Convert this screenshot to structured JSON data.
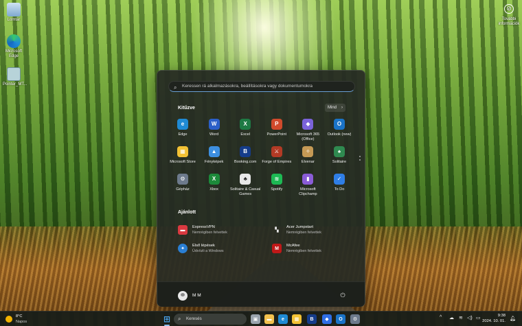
{
  "desktop": {
    "icons": [
      {
        "label": "Lomtár",
        "icon": "recycle-bin-icon",
        "color": "#9ec6e8"
      },
      {
        "label": "Microsoft Edge",
        "icon": "edge-icon",
        "color": "#1e8bd6"
      },
      {
        "label": "Pointer_MT...",
        "icon": "pointer-app-icon",
        "color": "#b7d3d9"
      }
    ],
    "widget_top_right": {
      "label": "További információk",
      "icon": "info-circle-icon"
    }
  },
  "start_menu": {
    "search_placeholder": "Keressen rá alkalmazásokra, beállításokra vagy dokumentumokra",
    "pinned_title": "Kitűzve",
    "all_button": "Mind",
    "pinned": [
      {
        "label": "Edge",
        "icon": "edge-icon",
        "color": "#1f8ad4"
      },
      {
        "label": "Word",
        "icon": "word-icon",
        "color": "#2b5fc8"
      },
      {
        "label": "Excel",
        "icon": "excel-icon",
        "color": "#1e7a44"
      },
      {
        "label": "PowerPoint",
        "icon": "powerpoint-icon",
        "color": "#d04a2c"
      },
      {
        "label": "Microsoft 365 (Office)",
        "icon": "microsoft-365-icon",
        "color": "#7b63d9"
      },
      {
        "label": "Outlook (new)",
        "icon": "outlook-icon",
        "color": "#1a73c7"
      },
      {
        "label": "Microsoft Store",
        "icon": "store-icon",
        "color": "#f3c235"
      },
      {
        "label": "Fényképek",
        "icon": "photos-icon",
        "color": "#3d8fe0"
      },
      {
        "label": "Booking.com",
        "icon": "booking-icon",
        "color": "#153c8a"
      },
      {
        "label": "Forge of Empires",
        "icon": "forge-of-empires-icon",
        "color": "#b23a25"
      },
      {
        "label": "Elvenar",
        "icon": "elvenar-icon",
        "color": "#c59a55"
      },
      {
        "label": "Solitaire",
        "icon": "solitaire-icon",
        "color": "#2f8a50"
      },
      {
        "label": "Gépház",
        "icon": "settings-gear-icon",
        "color": "#6d7a8c"
      },
      {
        "label": "Xbox",
        "icon": "xbox-icon",
        "color": "#1c8a3a"
      },
      {
        "label": "Solitaire & Casual Games",
        "icon": "solitaire-cards-icon",
        "color": "#e8e8e8"
      },
      {
        "label": "Spotify",
        "icon": "spotify-icon",
        "color": "#1db954"
      },
      {
        "label": "Microsoft Clipchamp",
        "icon": "clipchamp-icon",
        "color": "#8a5cd6"
      },
      {
        "label": "To Do",
        "icon": "todo-check-icon",
        "color": "#2f7ee6"
      }
    ],
    "recommended_title": "Ajánlott",
    "recommended": [
      {
        "name": "ExpressVPN",
        "sub": "Nemrégiben felvettek",
        "icon": "expressvpn-icon",
        "color": "#da3940"
      },
      {
        "name": "Acer Jumpstart",
        "sub": "Nemrégiben felvettek",
        "icon": "acer-jumpstart-icon",
        "color": "#e6e6e6"
      },
      {
        "name": "Első lépések",
        "sub": "Üdvözli a Windows",
        "icon": "get-started-icon",
        "color": "#2a7fd4"
      },
      {
        "name": "McAfee",
        "sub": "Nemrégiben felvettek",
        "icon": "mcafee-icon",
        "color": "#c01818"
      }
    ],
    "user_name": "M M",
    "power_icon": "power-icon"
  },
  "taskbar": {
    "weather_temp": "8°C",
    "weather_cond": "Napos",
    "search_label": "Keresés",
    "apps": [
      {
        "icon": "start-windows-icon",
        "color": "#4aa3ec",
        "glyph": "⊞"
      },
      {
        "icon": "task-view-icon",
        "color": "#9aa3ad",
        "glyph": "▣"
      },
      {
        "icon": "file-explorer-icon",
        "color": "#f2c14e",
        "glyph": "▬"
      },
      {
        "icon": "edge-icon",
        "color": "#1f8ad4",
        "glyph": "e"
      },
      {
        "icon": "store-icon",
        "color": "#f3c235",
        "glyph": "▦"
      },
      {
        "icon": "booking-icon",
        "color": "#153c8a",
        "glyph": "B"
      },
      {
        "icon": "dropbox-icon",
        "color": "#2f6ee6",
        "glyph": "◆"
      },
      {
        "icon": "outlook-icon",
        "color": "#1a73c7",
        "glyph": "O"
      },
      {
        "icon": "settings-gear-icon",
        "color": "#6d7a8c",
        "glyph": "⚙"
      }
    ],
    "time": "9:38",
    "date": "2024. 10. 01."
  }
}
